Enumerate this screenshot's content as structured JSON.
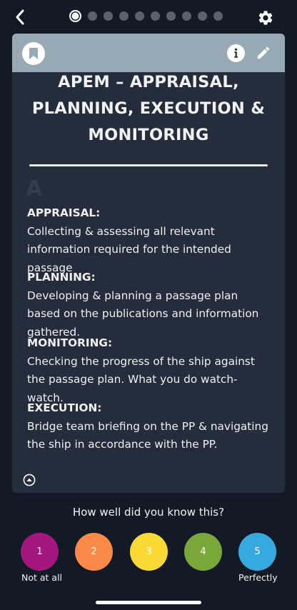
{
  "topbar": {
    "back_icon": "chevron-left-icon",
    "settings_icon": "gear-icon",
    "pagination": {
      "total": 10,
      "current": 1
    }
  },
  "card": {
    "header_color": "#96a9b5",
    "bookmark_icon": "bookmark-icon",
    "info_icon": "info-icon",
    "edit_icon": "pencil-icon",
    "title": "APEM – APPRAISAL, PLANNING, EXECUTION & MONITORING",
    "watermark": "A",
    "sections": [
      {
        "heading": "APPRAISAL:",
        "body": "Collecting & assessing all relevant information required for the intended passage"
      },
      {
        "heading": "PLANNING:",
        "body": "Developing & planning a passage plan based on the publications and information gathered."
      },
      {
        "heading": "MONITORING:",
        "body": "Checking the progress of the ship against the passage plan. What you do watch-watch."
      },
      {
        "heading": "EXECUTION:",
        "body": "Bridge team briefing on the PP & navigating the ship in accordance with the PP."
      }
    ],
    "collapse_icon": "chevron-up-circle-icon"
  },
  "rating": {
    "question": "How well did you know this?",
    "options": [
      {
        "label": "1",
        "color": "#a4177e"
      },
      {
        "label": "2",
        "color": "#f98a48"
      },
      {
        "label": "3",
        "color": "#fbd935"
      },
      {
        "label": "4",
        "color": "#79a73a"
      },
      {
        "label": "5",
        "color": "#36a9de"
      }
    ],
    "caption_low": "Not at all",
    "caption_high": "Perfectly"
  }
}
